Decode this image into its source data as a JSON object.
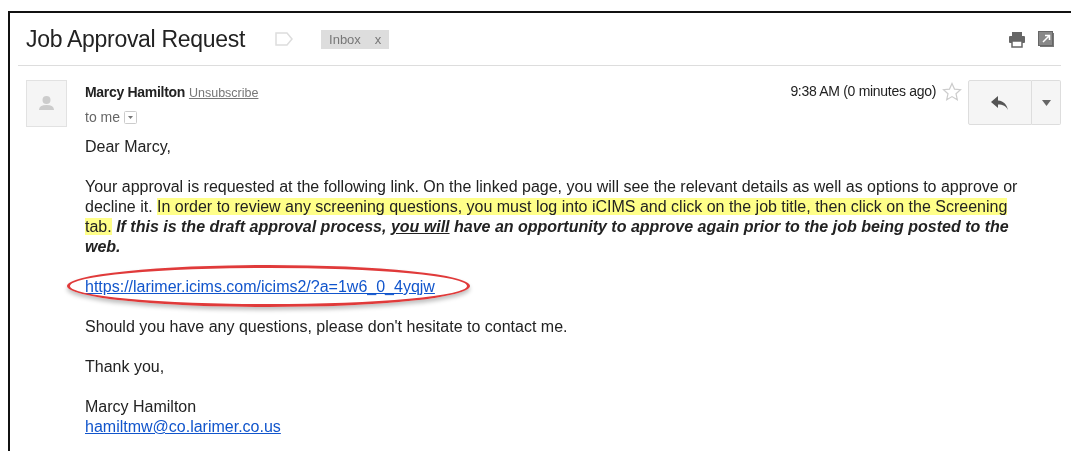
{
  "email": {
    "subject": "Job Approval Request",
    "label": {
      "text": "Inbox",
      "remove": "x"
    },
    "sender": {
      "name": "Marcy Hamilton",
      "unsubscribe": "Unsubscribe",
      "recipient": "to me"
    },
    "time": "9:38 AM (0 minutes ago)",
    "starred": false,
    "body": [
      {
        "kind": "text",
        "text": "Dear Marcy,"
      },
      {
        "kind": "rich",
        "segments": [
          {
            "kind": "plain",
            "text": "Your approval is requested at the following link.  On the linked page, you will see the relevant details as well as options to approve or decline it. "
          },
          {
            "kind": "highlighted",
            "text": "In order to review any screening questions, you must log into iCIMS and click on the job title, then click on the Screening tab."
          },
          {
            "kind": "emphasis",
            "text": " If this is the draft approval process, "
          },
          {
            "kind": "emphasis_underlined",
            "text": "you will"
          },
          {
            "kind": "emphasis",
            "text": " have an opportunity to approve again prior to the job being posted to the web."
          }
        ]
      },
      {
        "kind": "link",
        "text": "https://larimer.icims.com/icims2/?a=1w6_0_4yqjw",
        "circled": true
      },
      {
        "kind": "text",
        "text": "Should you have any questions, please don't hesitate to contact me."
      },
      {
        "kind": "text",
        "text": "Thank you,"
      },
      {
        "kind": "signature",
        "name": "Marcy Hamilton",
        "email": "hamiltmw@co.larimer.co.us"
      }
    ]
  }
}
